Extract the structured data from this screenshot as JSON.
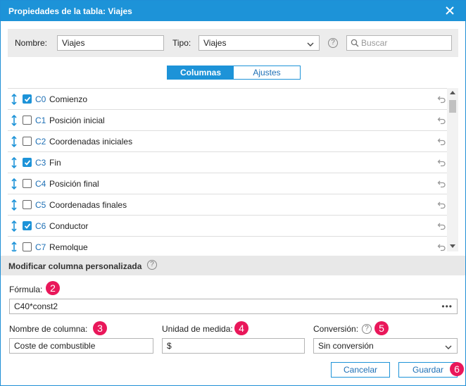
{
  "dialog": {
    "title": "Propiedades de la tabla: Viajes"
  },
  "filters": {
    "name_label": "Nombre:",
    "name_value": "Viajes",
    "type_label": "Tipo:",
    "type_value": "Viajes",
    "help_glyph": "?",
    "search_placeholder": "Buscar"
  },
  "tabs": [
    {
      "label": "Columnas",
      "active": true
    },
    {
      "label": "Ajustes",
      "active": false
    }
  ],
  "columns": [
    {
      "code": "C0",
      "name": "Comienzo",
      "checked": true
    },
    {
      "code": "C1",
      "name": "Posición inicial",
      "checked": false
    },
    {
      "code": "C2",
      "name": "Coordenadas iniciales",
      "checked": false
    },
    {
      "code": "C3",
      "name": "Fin",
      "checked": true
    },
    {
      "code": "C4",
      "name": "Posición final",
      "checked": false
    },
    {
      "code": "C5",
      "name": "Coordenadas finales",
      "checked": false
    },
    {
      "code": "C6",
      "name": "Conductor",
      "checked": true
    },
    {
      "code": "C7",
      "name": "Remolque",
      "checked": false
    }
  ],
  "custom_section": {
    "title": "Modificar columna personalizada",
    "help_glyph": "?",
    "formula_label": "Fórmula:",
    "formula_value": "C40*const2",
    "formula_more": "•••",
    "column_name_label": "Nombre de columna:",
    "column_name_value": "Coste de combustible",
    "unit_label": "Unidad de medida:",
    "unit_value": "$",
    "conversion_label": "Conversión:",
    "conversion_value": "Sin conversión"
  },
  "badges": [
    "2",
    "3",
    "4",
    "5",
    "6"
  ],
  "footer": {
    "cancel_label": "Cancelar",
    "save_label": "Guardar"
  },
  "colors": {
    "accent": "#1d93d8",
    "badge": "#e9175a",
    "link": "#1d6fb5"
  }
}
